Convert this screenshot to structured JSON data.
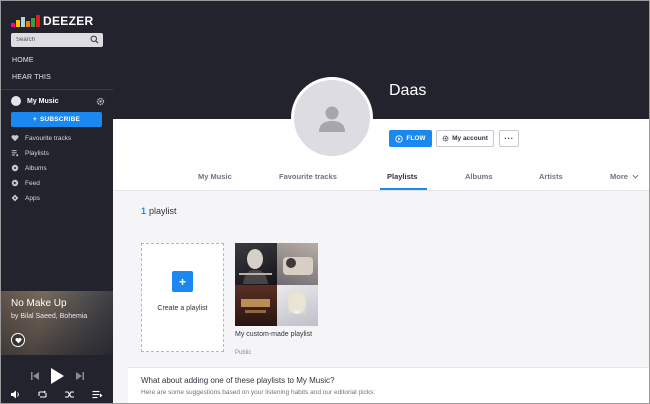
{
  "app": {
    "name": "DEEZER"
  },
  "search": {
    "placeholder": "Search"
  },
  "sidebar": {
    "nav_top": [
      {
        "label": "HOME"
      },
      {
        "label": "HEAR THIS"
      }
    ],
    "my_music_label": "My Music",
    "subscribe_label": "SUBSCRIBE",
    "items": [
      {
        "label": "Favourite tracks",
        "icon": "heart-icon"
      },
      {
        "label": "Playlists",
        "icon": "playlist-icon"
      },
      {
        "label": "Albums",
        "icon": "album-icon"
      },
      {
        "label": "Feed",
        "icon": "feed-icon"
      },
      {
        "label": "Apps",
        "icon": "apps-icon"
      }
    ]
  },
  "player": {
    "title": "No Make Up",
    "artist": "by Bilal Saeed, Bohemia"
  },
  "profile": {
    "name": "Daas",
    "flow_label": "FLOW",
    "account_label": "My account",
    "more_label": "···"
  },
  "tabs": [
    {
      "label": "My Music"
    },
    {
      "label": "Favourite tracks"
    },
    {
      "label": "Playlists"
    },
    {
      "label": "Albums"
    },
    {
      "label": "Artists"
    },
    {
      "label": "More"
    }
  ],
  "active_tab": "Playlists",
  "playlists": {
    "count": "1",
    "count_label": "playlist",
    "create_label": "Create a playlist",
    "items": [
      {
        "title": "My custom-made playlist",
        "visibility": "Public"
      }
    ]
  },
  "suggestions": {
    "title": "What about adding one of these playlists to My Music?",
    "subtitle": "Here are some suggestions based on your listening habits and our editorial picks:"
  },
  "colors": {
    "accent": "#1a88ee",
    "sidebar_bg": "#23232d",
    "header_bg": "#23232d",
    "content_bg": "#f5f5f7"
  }
}
